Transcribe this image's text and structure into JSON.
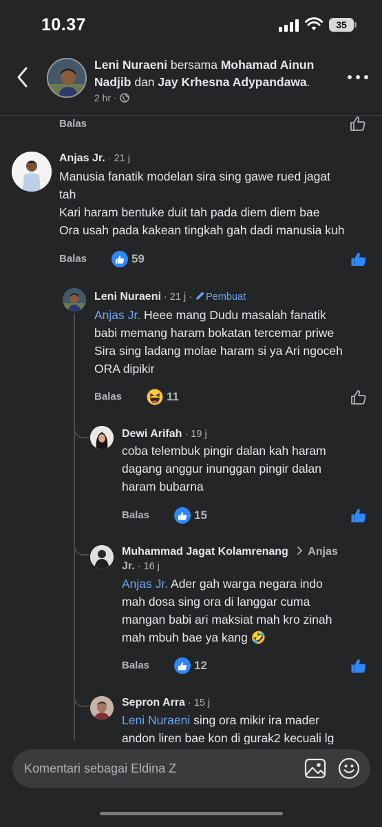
{
  "status_bar": {
    "time": "10.37",
    "battery": "35"
  },
  "header": {
    "author": "Leni Nuraeni",
    "with_word": " bersama ",
    "tagged_1": "Mohamad Ainun Nadjib",
    "and_word": " dan ",
    "tagged_2": "Jay Krhesna Adypandawa",
    "end": ".",
    "time": "2 hr",
    "dot": " · ",
    "privacy_icon": "globe-icon"
  },
  "reply_label": "Balas",
  "comments": [
    {
      "author": "Anjas Jr.",
      "time": " · 21 j",
      "lines": [
        "Manusia fanatik modelan sira sing gawe rued jagat",
        "tah",
        "Kari haram bentuke duit tah pada diem diem bae",
        "Ora usah pada kakean tingkah gah dadi manusia kuh"
      ],
      "reaction": "like",
      "count": "59"
    },
    {
      "author": "Leni Nuraeni",
      "time": " · 21 j · ",
      "badge": "Pembuat",
      "mention": "Anjas Jr.",
      "lines": [
        " Heee mang Dudu masalah fanatik",
        "babi memang haram bokatan tercemar priwe",
        "Sira sing ladang molae haram si ya Ari ngoceh",
        "ORA dipikir"
      ],
      "reaction": "haha",
      "count": "11"
    },
    {
      "author": "Dewi Arifah",
      "time": " · 19 j",
      "lines": [
        "coba telembuk pingir dalan kah haram",
        "dagang anggur inunggan pingir dalan",
        "haram bubarna"
      ],
      "reaction": "like",
      "count": "15"
    },
    {
      "author": "Muhammad Jagat Kolamrenang",
      "reply_to": "Anjas",
      "reply_to_line2": "Jr.",
      "time": " · 16 j",
      "mention": "Anjas Jr.",
      "lines": [
        " Ader gah warga negara indo",
        "mah dosa sing ora di langgar cuma",
        "mangan babi ari maksiat mah kro zinah",
        "mah mbuh bae ya kang 🤣"
      ],
      "reaction": "like",
      "count": "12"
    },
    {
      "author": "Sepron Arra",
      "time": " · 15 j",
      "mention": "Leni Nuraeni",
      "lines": [
        " sing ora mikir ira mader",
        "andon liren bae kon di gurak2 kecuali lg"
      ]
    }
  ],
  "composer": {
    "placeholder": "Komentari sebagai Eldina Z"
  }
}
